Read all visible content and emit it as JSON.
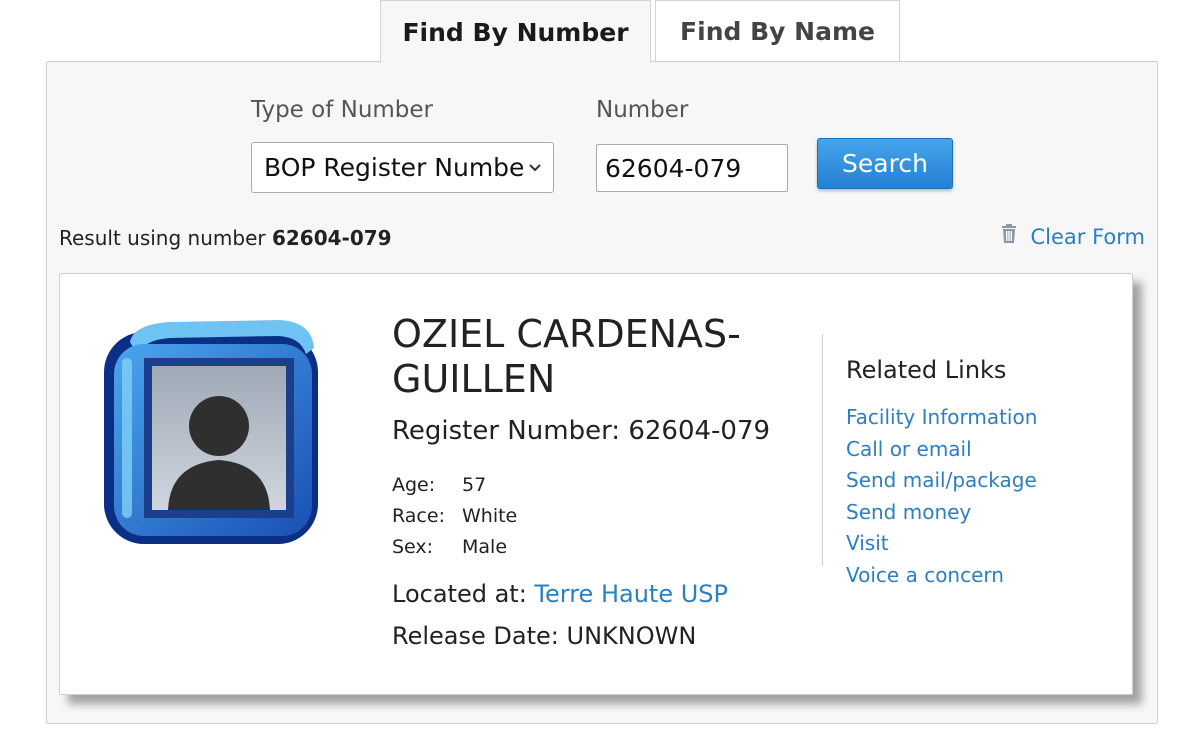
{
  "tabs": [
    {
      "label": "Find By Number",
      "active": true
    },
    {
      "label": "Find By Name",
      "active": false
    }
  ],
  "search_form": {
    "type_label": "Type of Number",
    "type_selected": "BOP Register Number",
    "number_label": "Number",
    "number_value": "62604-079",
    "search_button": "Search"
  },
  "result": {
    "prefix": "Result using number",
    "number": "62604-079",
    "clear_form": "Clear Form"
  },
  "inmate": {
    "name": "OZIEL CARDENAS-GUILLEN",
    "register_prefix": "Register Number:",
    "register_number": "62604-079",
    "age_label": "Age:",
    "age": "57",
    "race_label": "Race:",
    "race": "White",
    "sex_label": "Sex:",
    "sex": "Male",
    "located_label": "Located at:",
    "facility": "Terre Haute USP",
    "release_label": "Release Date:",
    "release_date": "UNKNOWN"
  },
  "related_links": {
    "title": "Related Links",
    "items": [
      "Facility Information",
      "Call or email",
      "Send mail/package",
      "Send money",
      "Visit",
      "Voice a concern"
    ]
  },
  "icons": {
    "trash": "trash-icon",
    "avatar": "default-person-avatar-icon",
    "select_chevron": "chevron-down-icon"
  },
  "colors": {
    "link": "#2c7fc0",
    "button": "#2f8ee0",
    "avatar_frame": "#1f63c9"
  }
}
